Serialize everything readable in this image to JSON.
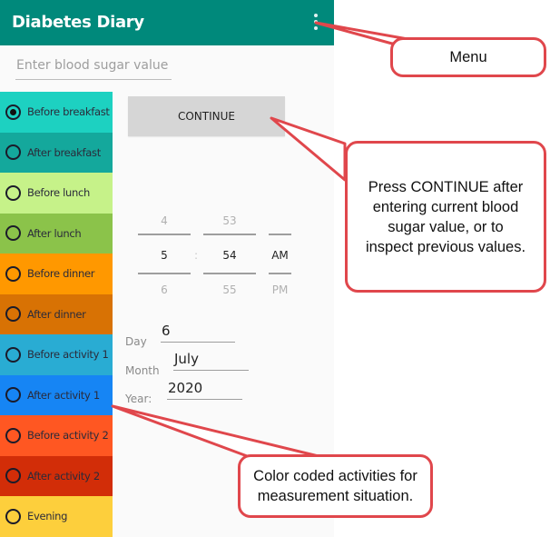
{
  "app": {
    "title": "Diabetes Diary",
    "menu_icon": "more-vert-icon",
    "header_color": "#00897b"
  },
  "blood_sugar_input": {
    "value": "",
    "placeholder": "Enter blood sugar value"
  },
  "activities": [
    {
      "label": "Before breakfast",
      "color": "#1dd1c1",
      "selected": true
    },
    {
      "label": "After breakfast",
      "color": "#14a89c",
      "selected": false
    },
    {
      "label": "Before lunch",
      "color": "#c6f289",
      "selected": false
    },
    {
      "label": "After lunch",
      "color": "#8bc34a",
      "selected": false
    },
    {
      "label": "Before dinner",
      "color": "#ff9800",
      "selected": false
    },
    {
      "label": "After dinner",
      "color": "#d87204",
      "selected": false
    },
    {
      "label": "Before activity 1",
      "color": "#29acd3",
      "selected": false
    },
    {
      "label": "After activity 1",
      "color": "#1685f4",
      "selected": false
    },
    {
      "label": "Before activity 2",
      "color": "#ff5722",
      "selected": false
    },
    {
      "label": "After activity 2",
      "color": "#d22d08",
      "selected": false
    },
    {
      "label": "Evening",
      "color": "#fdcf3c",
      "selected": false
    }
  ],
  "continue_button": {
    "label": "CONTINUE"
  },
  "time_picker": {
    "hour": {
      "prev": "4",
      "current": "5",
      "next": "6"
    },
    "separator": ":",
    "minute": {
      "prev": "53",
      "current": "54",
      "next": "55"
    },
    "ampm": {
      "current": "AM",
      "next": "PM"
    }
  },
  "date": {
    "day_label": "Day",
    "day_value": "6",
    "month_label": "Month",
    "month_value": "July",
    "year_label": "Year:",
    "year_value": "2020"
  },
  "callouts": {
    "menu": "Menu",
    "continue": "Press CONTINUE after entering current blood sugar value, or to inspect previous values.",
    "activities": "Color coded activities for measurement situation.",
    "border_color": "#e0474c"
  }
}
